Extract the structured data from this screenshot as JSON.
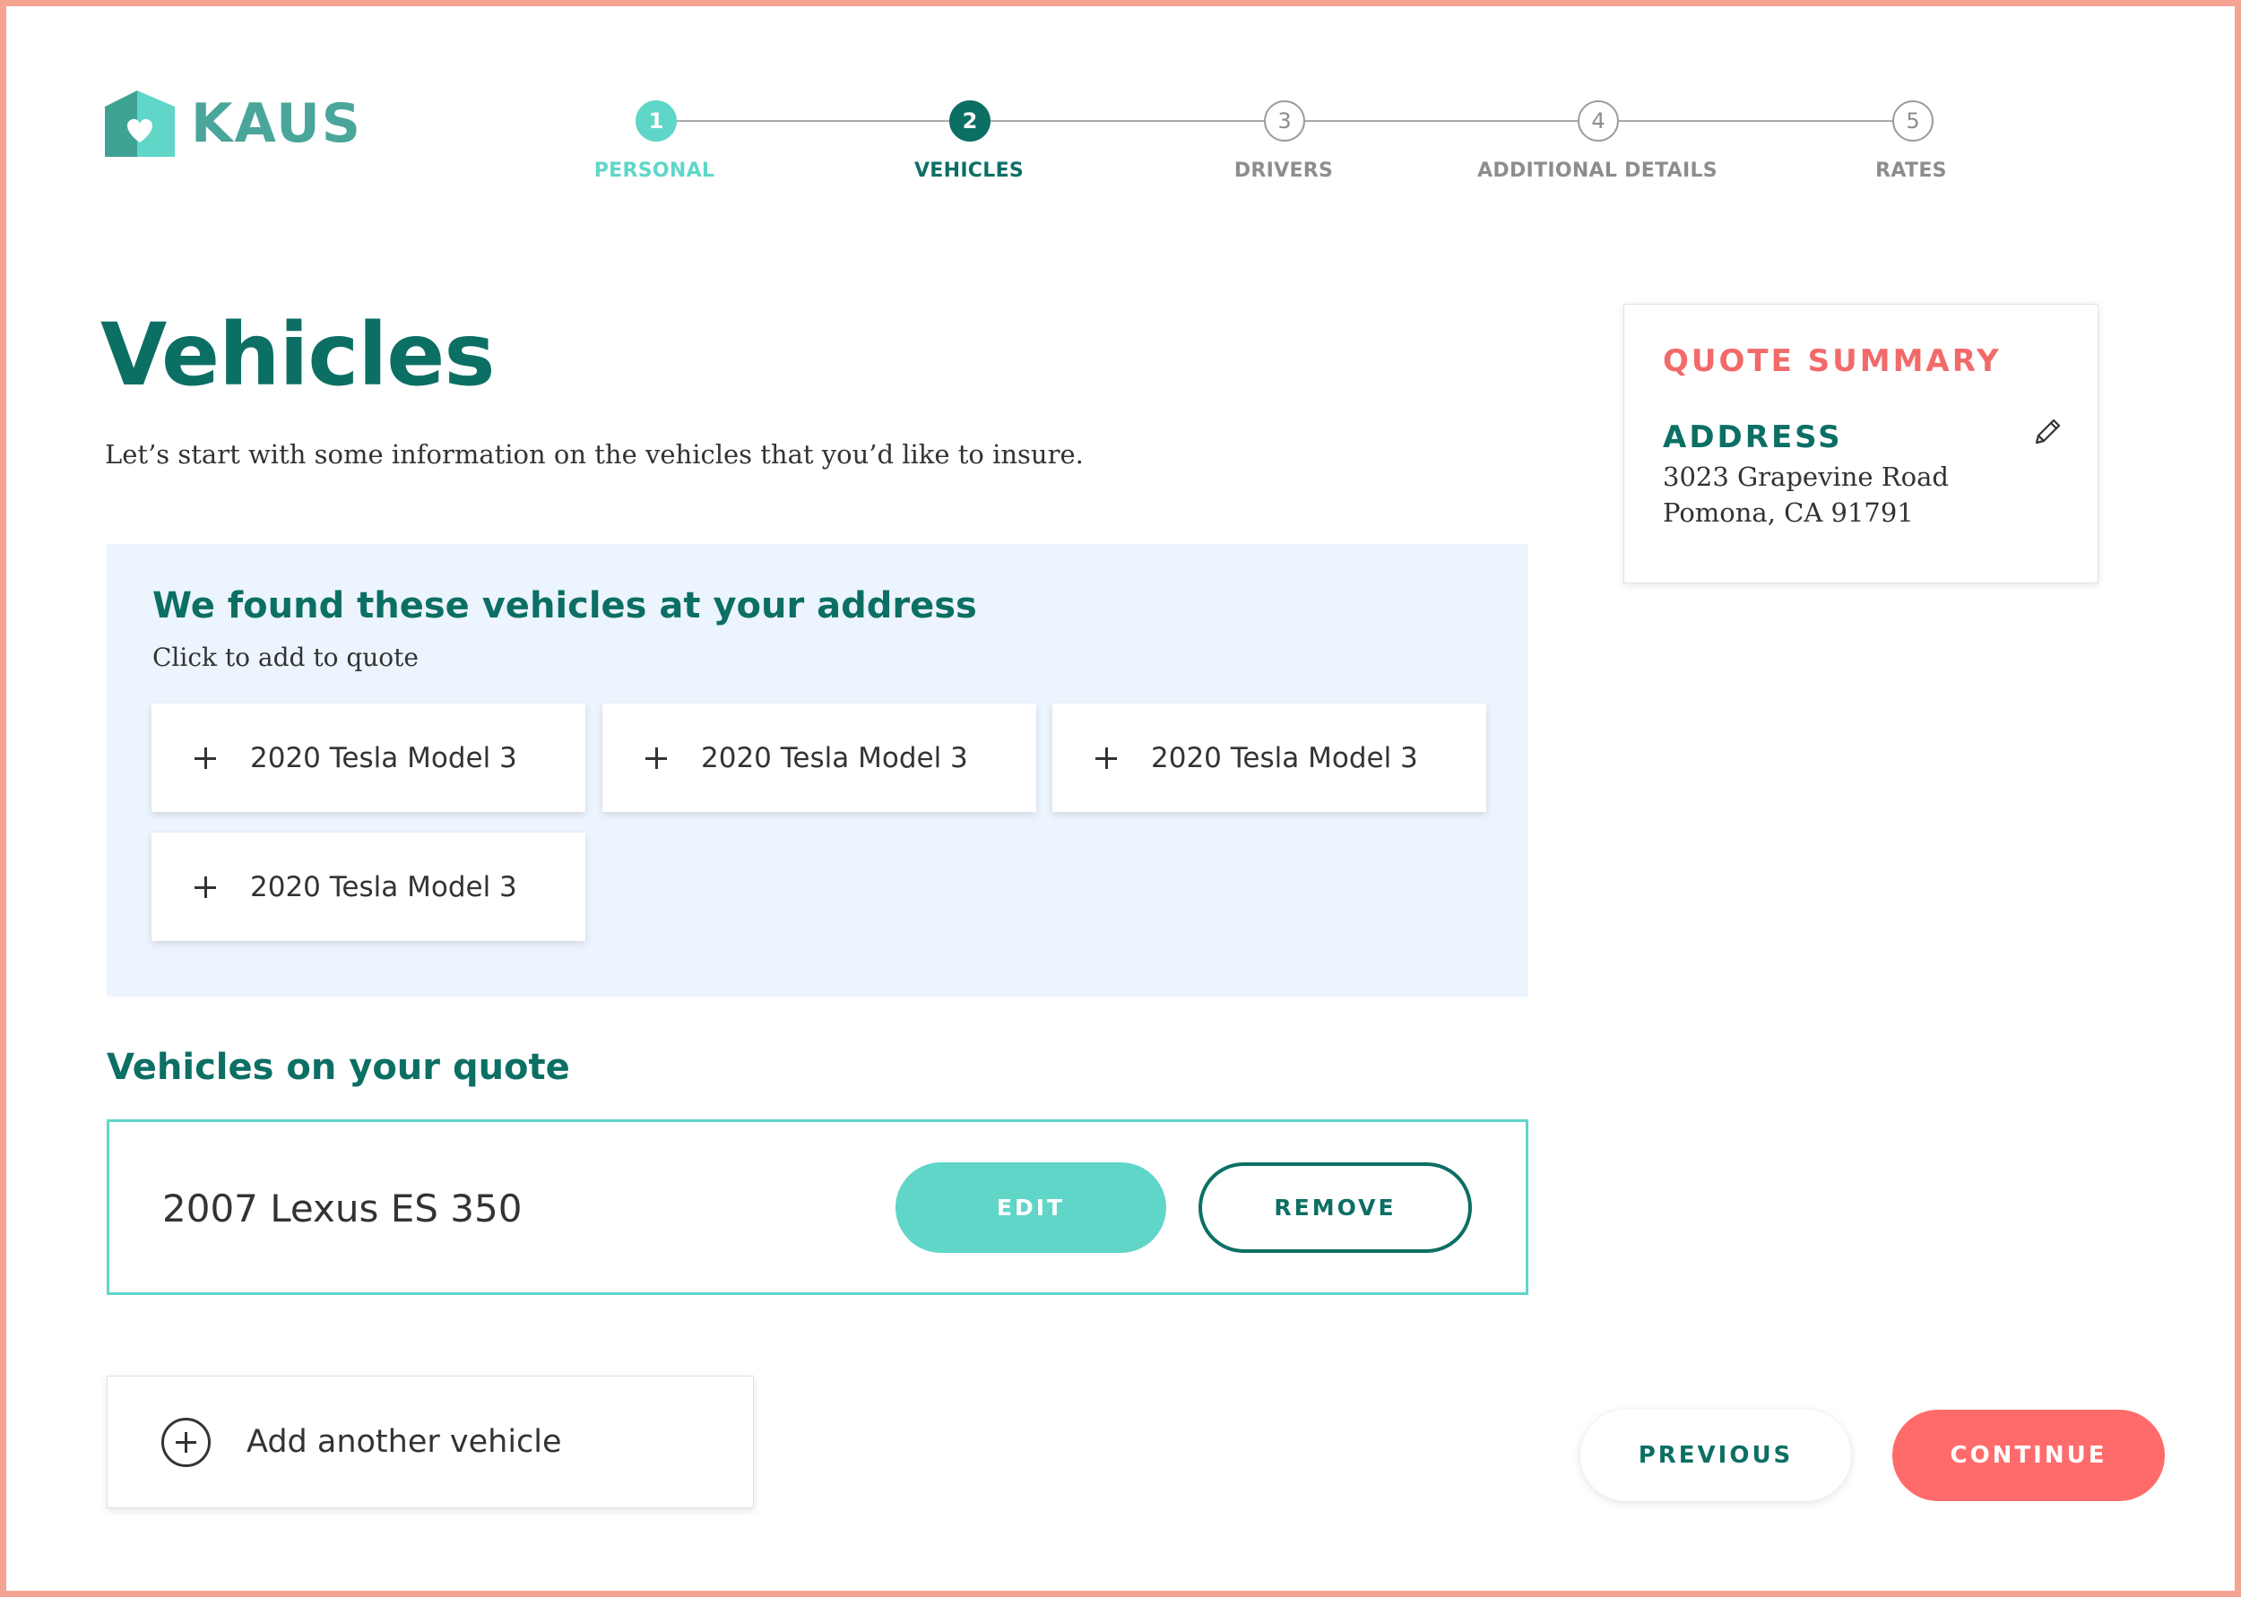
{
  "brand": {
    "name": "KAUS",
    "logo_icon": "house-heart-icon",
    "colors": {
      "primary": "#0c6f64",
      "accent": "#5fd6c8",
      "coral": "#ff6b6b",
      "panel": "#ecf4fd"
    }
  },
  "stepper": {
    "steps": [
      {
        "number": "1",
        "label": "PERSONAL",
        "state": "done"
      },
      {
        "number": "2",
        "label": "VEHICLES",
        "state": "active"
      },
      {
        "number": "3",
        "label": "DRIVERS",
        "state": "upcoming"
      },
      {
        "number": "4",
        "label": "ADDITIONAL DETAILS",
        "state": "upcoming"
      },
      {
        "number": "5",
        "label": "RATES",
        "state": "upcoming"
      }
    ]
  },
  "page": {
    "title": "Vehicles",
    "intro": "Let’s start with some information on the vehicles that you’d like to insure."
  },
  "found": {
    "title": "We found these vehicles at your address",
    "subtitle": "Click to add to quote",
    "vehicles": [
      {
        "name": "2020 Tesla Model 3"
      },
      {
        "name": "2020 Tesla Model 3"
      },
      {
        "name": "2020 Tesla Model 3"
      },
      {
        "name": "2020 Tesla Model 3"
      }
    ]
  },
  "quote": {
    "heading": "Vehicles on your quote",
    "vehicles": [
      {
        "name": "2007 Lexus ES 350",
        "edit_label": "EDIT",
        "remove_label": "REMOVE"
      }
    ],
    "add_label": "Add another vehicle"
  },
  "summary": {
    "title": "QUOTE SUMMARY",
    "address_label": "ADDRESS",
    "address_line1": "3023 Grapevine Road",
    "address_line2": "Pomona, CA 91791"
  },
  "nav": {
    "previous_label": "PREVIOUS",
    "continue_label": "CONTINUE"
  }
}
